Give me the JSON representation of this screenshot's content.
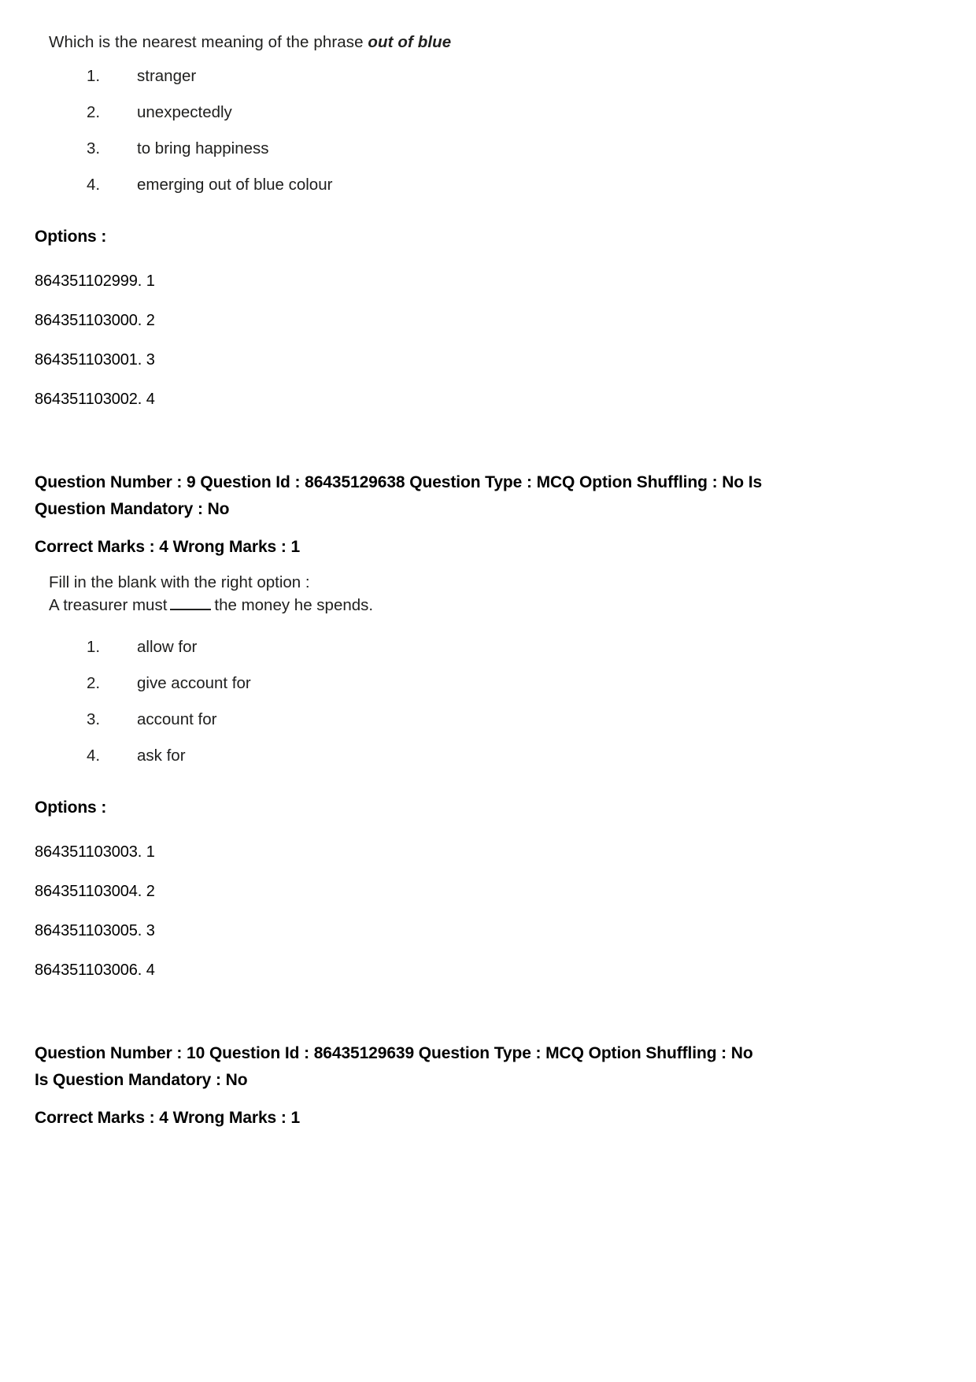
{
  "page": {
    "background_color": "#ffffff",
    "text_color": "#000000",
    "scan_text_color": "#20201f"
  },
  "questions": [
    {
      "id": "question-8-continued",
      "stem_prefix": "Which is the nearest meaning of the phrase ",
      "stem_emphasis": "out of blue",
      "stem_suffix": "",
      "choices": [
        {
          "number": "1.",
          "text": "stranger"
        },
        {
          "number": "2.",
          "text": "unexpectedly"
        },
        {
          "number": "3.",
          "text": "to bring happiness"
        },
        {
          "number": "4.",
          "text": "emerging out of blue colour"
        }
      ],
      "options_label": "Options :",
      "option_ids": [
        "864351102999. 1",
        "864351103000. 2",
        "864351103001. 3",
        "864351103002. 4"
      ]
    },
    {
      "id": "question-9",
      "header_line_1": "Question Number : 9 Question Id : 86435129638 Question Type : MCQ Option Shuffling : No Is",
      "header_line_2": "Question Mandatory : No",
      "marks_line": "Correct Marks : 4 Wrong Marks : 1",
      "instruction": "Fill in the blank with the right option :",
      "sentence_before_blank": "A treasurer must",
      "sentence_after_blank": "the money he spends.",
      "choices": [
        {
          "number": "1.",
          "text": "allow for"
        },
        {
          "number": "2.",
          "text": "give account for"
        },
        {
          "number": "3.",
          "text": "account for"
        },
        {
          "number": "4.",
          "text": "ask for"
        }
      ],
      "options_label": "Options :",
      "option_ids": [
        "864351103003. 1",
        "864351103004. 2",
        "864351103005. 3",
        "864351103006. 4"
      ]
    },
    {
      "id": "question-10",
      "header_line_1": "Question Number : 10 Question Id : 86435129639 Question Type : MCQ Option Shuffling : No",
      "header_line_2": "Is Question Mandatory : No",
      "marks_line": "Correct Marks : 4 Wrong Marks : 1"
    }
  ]
}
